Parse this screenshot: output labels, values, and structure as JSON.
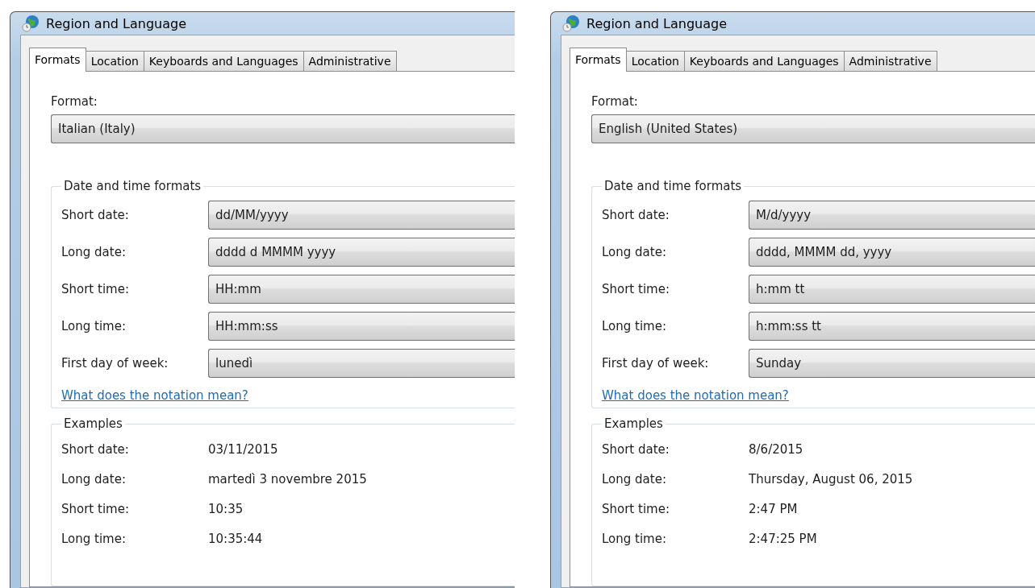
{
  "windows": [
    {
      "title": "Region and Language",
      "tabs": [
        {
          "label": "Formats",
          "selected": true
        },
        {
          "label": "Location",
          "selected": false
        },
        {
          "label": "Keyboards and Languages",
          "selected": false
        },
        {
          "label": "Administrative",
          "selected": false
        }
      ],
      "format_label": "Format:",
      "format": "Italian (Italy)",
      "formats_group": {
        "title": "Date and time formats",
        "rows": [
          {
            "label": "Short date:",
            "value": "dd/MM/yyyy"
          },
          {
            "label": "Long date:",
            "value": "dddd d MMMM yyyy"
          },
          {
            "label": "Short time:",
            "value": "HH:mm"
          },
          {
            "label": "Long time:",
            "value": "HH:mm:ss"
          },
          {
            "label": "First day of week:",
            "value": "lunedì"
          }
        ]
      },
      "link": "What does the notation mean?",
      "examples": {
        "title": "Examples",
        "rows": [
          {
            "label": "Short date:",
            "value": "03/11/2015"
          },
          {
            "label": "Long date:",
            "value": "martedì 3 novembre 2015"
          },
          {
            "label": "Short time:",
            "value": "10:35"
          },
          {
            "label": "Long time:",
            "value": "10:35:44"
          }
        ]
      }
    },
    {
      "title": "Region and Language",
      "tabs": [
        {
          "label": "Formats",
          "selected": true
        },
        {
          "label": "Location",
          "selected": false
        },
        {
          "label": "Keyboards and Languages",
          "selected": false
        },
        {
          "label": "Administrative",
          "selected": false
        }
      ],
      "format_label": "Format:",
      "format": "English (United States)",
      "formats_group": {
        "title": "Date and time formats",
        "rows": [
          {
            "label": "Short date:",
            "value": "M/d/yyyy"
          },
          {
            "label": "Long date:",
            "value": "dddd, MMMM dd, yyyy"
          },
          {
            "label": "Short time:",
            "value": "h:mm tt"
          },
          {
            "label": "Long time:",
            "value": "h:mm:ss tt"
          },
          {
            "label": "First day of week:",
            "value": "Sunday"
          }
        ]
      },
      "link": "What does the notation mean?",
      "examples": {
        "title": "Examples",
        "rows": [
          {
            "label": "Short date:",
            "value": "8/6/2015"
          },
          {
            "label": "Long date:",
            "value": "Thursday, August 06, 2015"
          },
          {
            "label": "Short time:",
            "value": "2:47 PM"
          },
          {
            "label": "Long time:",
            "value": "2:47:25 PM"
          }
        ]
      }
    }
  ]
}
